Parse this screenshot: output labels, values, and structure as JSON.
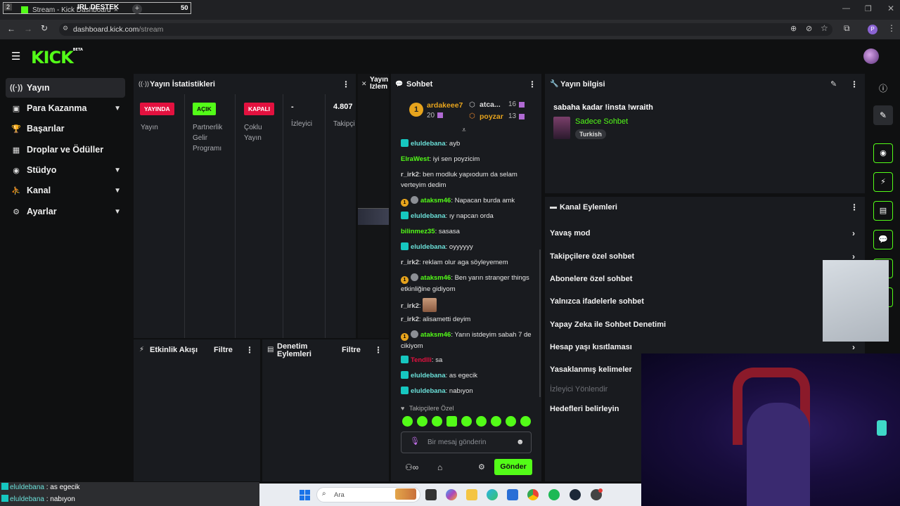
{
  "browser": {
    "tab_num_badge": "2",
    "tab_title": "Stream - Kick Dashboard",
    "overlay_title": "IRL DESTEK",
    "overlay_count": "50",
    "url_domain": "dashboard.kick.com",
    "url_path": "/stream",
    "profile_initial": "P"
  },
  "kick": {
    "logo": "KICK",
    "beta": "BETA"
  },
  "sidebar": {
    "items": [
      {
        "label": "Yayın",
        "icon": "broadcast-icon"
      },
      {
        "label": "Para Kazanma",
        "icon": "wallet-icon"
      },
      {
        "label": "Başarılar",
        "icon": "trophy-icon"
      },
      {
        "label": "Droplar ve Ödüller",
        "icon": "gift-icon"
      },
      {
        "label": "Stüdyo",
        "icon": "studio-icon"
      },
      {
        "label": "Kanal",
        "icon": "channel-icon"
      },
      {
        "label": "Ayarlar",
        "icon": "gear-icon"
      }
    ]
  },
  "stats": {
    "title": "Yayın İstatistikleri",
    "live_badge": "YAYINDA",
    "live_label": "Yayın",
    "partner_badge": "AÇIK",
    "partner_label_1": "Partnerlik",
    "partner_label_2": "Gelir",
    "partner_label_3": "Programı",
    "multi_badge": "KAPALI",
    "multi_label_1": "Çoklu",
    "multi_label_2": "Yayın",
    "viewers_value": "-",
    "viewers_label": "İzleyici",
    "followers_value": "4.807",
    "followers_label": "Takipçi"
  },
  "preview": {
    "title_1": "Yayın",
    "title_2": "İzlem"
  },
  "activity": {
    "title": "Etkinlik Akışı",
    "filter": "Filtre"
  },
  "moderation": {
    "title_1": "Denetim",
    "title_2": "Eylemleri",
    "filter": "Filtre"
  },
  "chat": {
    "title": "Sohbet",
    "top1": {
      "name": "ardakeee7",
      "count": "20",
      "rank": "1"
    },
    "top2": {
      "name": "atca...",
      "count": "16"
    },
    "top3": {
      "name": "poyzar",
      "count": "13"
    },
    "messages": [
      {
        "user": "eluldebana",
        "text": "ayb"
      },
      {
        "user": "ElraWest",
        "text": "iyi sen poyzicim"
      },
      {
        "user": "r_irk2",
        "text": "ben modluk yapıodum da selam verteyim dedim"
      },
      {
        "user": "ataksm46",
        "text": "Napacan burda amk"
      },
      {
        "user": "eluldebana",
        "text": "ıy napcan orda"
      },
      {
        "user": "bilinmez35",
        "text": "sasasa"
      },
      {
        "user": "eluldebana",
        "text": "oyyyyyy"
      },
      {
        "user": "r_irk2",
        "text": "reklam olur aga söyleyemem"
      },
      {
        "user": "ataksm46",
        "text": "Ben yarın stranger things etkinliğine gidiyom"
      },
      {
        "user": "r_irk2",
        "text": ""
      },
      {
        "user": "r_irk2",
        "text": "alisametti deyim"
      },
      {
        "user": "ataksm46",
        "text": "Yarın istdeyim sabah 7 de cikiyom"
      },
      {
        "user": "Tendlli",
        "text": "sa"
      },
      {
        "user": "eluldebana",
        "text": "as egecik"
      },
      {
        "user": "eluldebana",
        "text": "nabıyon"
      }
    ],
    "followers_only": "Takipçilere Özel",
    "input_placeholder": "Bir mesaj gönderin",
    "send": "Gönder"
  },
  "stream_info": {
    "title": "Yayın bilgisi",
    "stream_title": "sabaha kadar !insta !wraith",
    "category": "Sadece Sohbet",
    "language": "Turkish"
  },
  "channel_actions": {
    "title": "Kanal Eylemleri",
    "items": [
      "Yavaş mod",
      "Takipçilere özel sohbet",
      "Abonelere özel sohbet",
      "Yalnızca ifadelerle sohbet",
      "Yapay Zeka ile Sohbet Denetimi",
      "Hesap yaşı kısıtlaması",
      "Yasaklanmış kelimeler",
      "İzleyici Yönlendir",
      "Hedefleri belirleyin"
    ]
  },
  "overlay_chat": [
    {
      "user": "eluldebana",
      "text": "as egecik"
    },
    {
      "user": "eluldebana",
      "text": "nabıyon"
    }
  ],
  "taskbar": {
    "search_placeholder": "Ara"
  },
  "colors": {
    "kick_green": "#53fc18",
    "live_red": "#e3113f",
    "teal": "#16c7c0",
    "gold": "#e7a41d"
  }
}
